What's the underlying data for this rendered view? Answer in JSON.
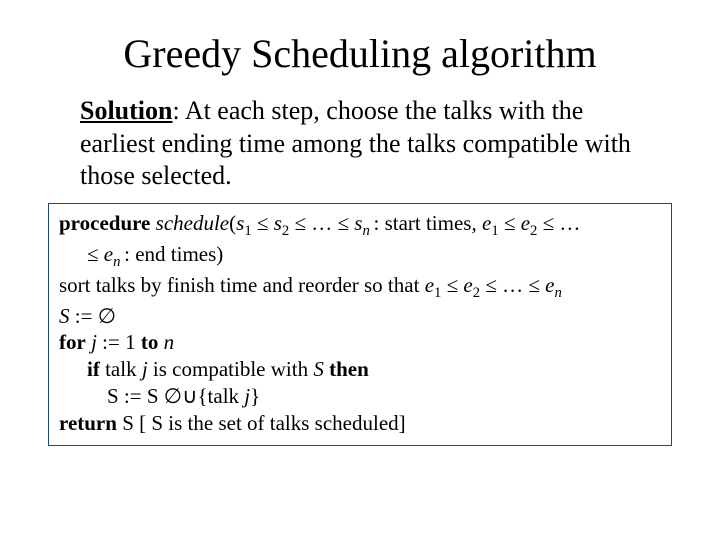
{
  "title": "Greedy Scheduling algorithm",
  "solution": {
    "label": "Solution",
    "text": ": At each step, choose the talks with the earliest ending time among the talks compatible with those selected."
  },
  "algo": {
    "kw_procedure": "procedure",
    "proc_name": "schedule",
    "sig_open": "(",
    "sig_s1": "s",
    "sig_sub1": "1",
    "le": " ≤ ",
    "sig_s2": "s",
    "sig_sub2": "2",
    "dots": " … ",
    "sig_sn": "s",
    "sig_subn": "n ",
    "sig_start": ": start times",
    "comma": ", ",
    "sig_e1": "e",
    "sig_e2": "e",
    "sig_en": "e",
    "sig_end": ": end times)",
    "sort_line_a": "sort talks by finish time and reorder so that ",
    "sinit": "S",
    "assign": " := ",
    "empty": "∅",
    "kw_for": "for",
    "for_var": "  j ",
    "for_init": ":= 1 ",
    "kw_to": "to",
    "for_n": " n",
    "kw_if": "if",
    "if_text_a": " talk ",
    "if_j": "j",
    "if_text_b": " is compatible with ",
    "if_S": "S ",
    "kw_then": "then",
    "update_a": "S := S ",
    "update_sym": "∅∪",
    "update_b": "{talk ",
    "update_j": "j",
    "update_c": "}",
    "kw_return": "return",
    "ret_text": " S [ S is the set of talks scheduled]"
  }
}
